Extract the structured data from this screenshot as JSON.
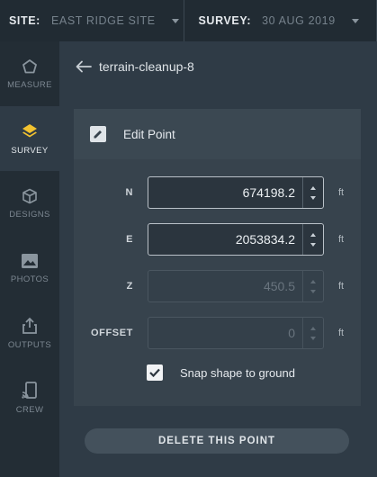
{
  "topbar": {
    "site_label": "SITE:",
    "site_value": "EAST RIDGE SITE",
    "survey_label": "SURVEY:",
    "survey_value": "30 AUG 2019"
  },
  "nav": {
    "items": [
      {
        "label": "MEASURE",
        "icon": "pentagon-icon",
        "active": false
      },
      {
        "label": "SURVEY",
        "icon": "layers-icon",
        "active": true
      },
      {
        "label": "DESIGNS",
        "icon": "cube-icon",
        "active": false
      },
      {
        "label": "PHOTOS",
        "icon": "photo-icon",
        "active": false
      },
      {
        "label": "OUTPUTS",
        "icon": "share-icon",
        "active": false
      },
      {
        "label": "CREW",
        "icon": "mobile-cast-icon",
        "active": false
      }
    ]
  },
  "header": {
    "title": "terrain-cleanup-8"
  },
  "panel": {
    "title": "Edit Point",
    "fields": {
      "n": {
        "label": "N",
        "value": "674198.2",
        "unit": "ft",
        "disabled": false
      },
      "e": {
        "label": "E",
        "value": "2053834.2",
        "unit": "ft",
        "disabled": false
      },
      "z": {
        "label": "Z",
        "value": "450.5",
        "unit": "ft",
        "disabled": true
      },
      "offset": {
        "label": "OFFSET",
        "value": "0",
        "unit": "ft",
        "disabled": true
      }
    },
    "snap_label": "Snap shape to ground",
    "snap_checked": true
  },
  "actions": {
    "delete_label": "DELETE THIS POINT"
  },
  "colors": {
    "background": "#2f3b46",
    "sidebar": "#232d35",
    "topbar": "#212b33",
    "accent_icon": "#f2c230"
  }
}
